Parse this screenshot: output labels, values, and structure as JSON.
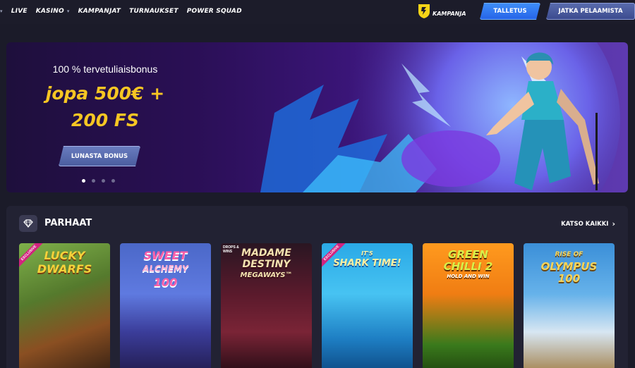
{
  "nav": {
    "items": [
      {
        "label": "LIVE",
        "dropdown": false
      },
      {
        "label": "KASINO",
        "dropdown": true
      },
      {
        "label": "KAMPANJAT",
        "dropdown": false
      },
      {
        "label": "TURNAUKSET",
        "dropdown": false
      },
      {
        "label": "POWER SQUAD",
        "dropdown": false
      }
    ],
    "promo_label": "KAMPANJA",
    "deposit_label": "TALLETUS",
    "continue_label": "JATKA PELAAMISTA"
  },
  "hero": {
    "subtitle": "100 % tervetuliaisbonus",
    "amount_line1": "jopa 500€ +",
    "amount_line2": "200 FS",
    "cta_label": "LUNASTA BONUS",
    "slides": 4,
    "active_slide": 1
  },
  "section": {
    "title": "PARHAAT",
    "see_all_label": "KATSO KAIKKI",
    "icon": "diamond-icon",
    "games": [
      {
        "title_lines": [
          "LUCKY",
          "DWARFS"
        ],
        "badge": "EXCLUSIVE",
        "color": "#f5d23a"
      },
      {
        "title_lines": [
          "SWEET",
          "ALCHEMY",
          "100"
        ],
        "badge": "",
        "color": "#ff5fa8"
      },
      {
        "title_lines": [
          "MADAME",
          "DESTINY",
          "MEGAWAYS™"
        ],
        "badge": "DROPS & WINS",
        "color": "#f3e3b0"
      },
      {
        "title_lines": [
          "IT'S",
          "SHARK TIME!"
        ],
        "badge": "EXCLUSIVE",
        "color": "#fff0a0"
      },
      {
        "title_lines": [
          "GREEN",
          "CHILLI 2",
          "HOLD AND WIN"
        ],
        "badge": "",
        "color": "#d8f04a"
      },
      {
        "title_lines": [
          "RISE OF",
          "OLYMPUS",
          "100"
        ],
        "badge": "",
        "color": "#f5d35a"
      }
    ]
  },
  "colors": {
    "accent_gold": "#f6c623",
    "deposit_blue": "#2f7ef0",
    "background": "#1b1b29"
  }
}
